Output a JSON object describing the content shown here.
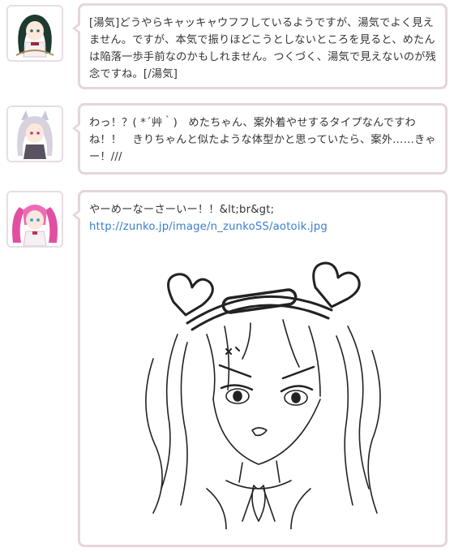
{
  "messages": [
    {
      "speaker_icon": "green-hair-girl-avatar",
      "text": "[湯気]どうやらキャッキャウフフしているようですが、湯気でよく見えません。ですが、本気で振りほどこうとしないところを見ると、めたんは陥落一歩手前なのかもしれません。つくづく、湯気で見えないのが残念ですね。[/湯気]"
    },
    {
      "speaker_icon": "silver-hair-catgirl-avatar",
      "text": "わっ！？( *´艸｀)　めたちゃん、案外着やせするタイプなんですわね！！　きりちゃんと似たような体型かと思っていたら、案外……きゃー！///"
    },
    {
      "speaker_icon": "pink-twintail-maid-avatar",
      "text": "やーめーなーさーいー！！&lt;br&gt;",
      "link": "http://zunko.jp/image/n_zunkoSS/aotoik.jpg",
      "image_icon": "angry-maid-girl-sketch"
    }
  ],
  "colors": {
    "bubble_border": "#e5d5db",
    "link": "#3a7ec9",
    "text": "#333333"
  }
}
